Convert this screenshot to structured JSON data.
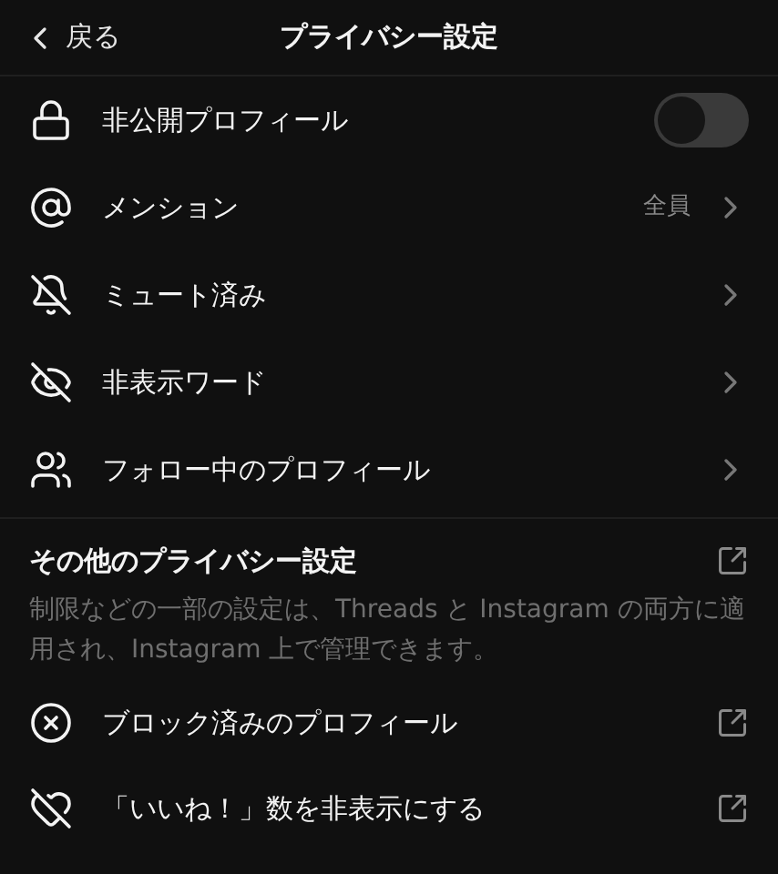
{
  "header": {
    "back": "戻る",
    "title": "プライバシー設定"
  },
  "items": [
    {
      "kind": "toggle",
      "label": "非公開プロフィール",
      "on": false
    },
    {
      "kind": "link",
      "label": "メンション",
      "value": "全員"
    },
    {
      "kind": "link",
      "label": "ミュート済み"
    },
    {
      "kind": "link",
      "label": "非表示ワード"
    },
    {
      "kind": "link",
      "label": "フォロー中のプロフィール"
    }
  ],
  "other": {
    "title": "その他のプライバシー設定",
    "description": "制限などの一部の設定は、Threads と Instagram の両方に適用され、Instagram 上で管理できます。",
    "items": [
      {
        "label": "ブロック済みのプロフィール"
      },
      {
        "label": "「いいね！」数を非表示にする"
      }
    ]
  }
}
